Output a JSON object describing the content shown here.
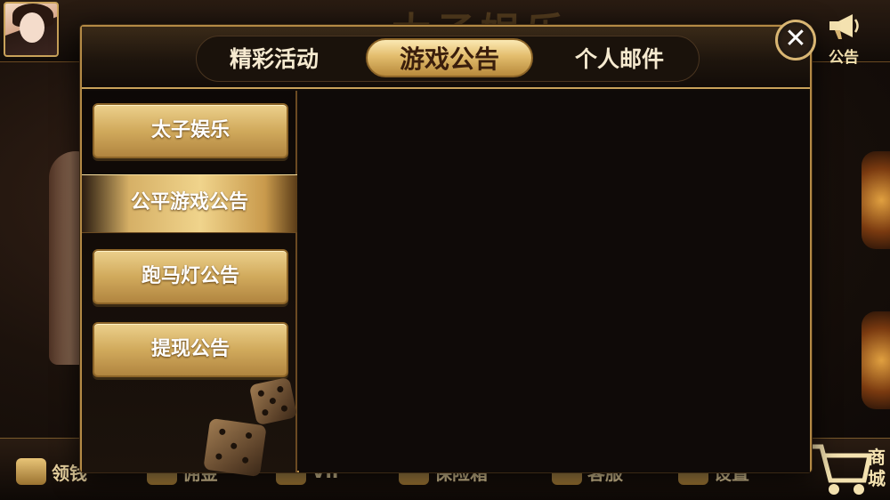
{
  "header": {
    "announcement_label": "公告",
    "background_title": "太子娱乐"
  },
  "dialog": {
    "tabs": [
      {
        "label": "精彩活动",
        "active": false
      },
      {
        "label": "游戏公告",
        "active": true
      },
      {
        "label": "个人邮件",
        "active": false
      }
    ],
    "close_symbol": "✕",
    "sidebar": [
      {
        "label": "太子娱乐",
        "active": false
      },
      {
        "label": "公平游戏公告",
        "active": true
      },
      {
        "label": "跑马灯公告",
        "active": false
      },
      {
        "label": "提现公告",
        "active": false
      }
    ]
  },
  "bottom_bar": {
    "items": [
      "领钱",
      "佣金",
      "VIP",
      "保险箱",
      "客服",
      "设置"
    ],
    "shop_label": "商城"
  },
  "colors": {
    "gold": "#d1aa5c",
    "active_tab_text": "#3a1e0c",
    "panel_bg": "#0f0a08"
  }
}
